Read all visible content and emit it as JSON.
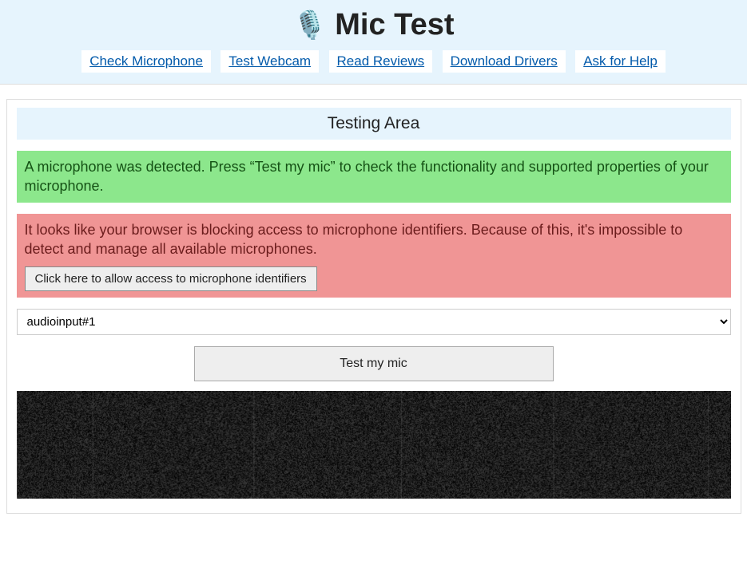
{
  "header": {
    "title": "Mic Test",
    "mic_icon": "🎙️"
  },
  "nav": [
    {
      "label": "Check Microphone"
    },
    {
      "label": "Test Webcam"
    },
    {
      "label": "Read Reviews"
    },
    {
      "label": "Download Drivers"
    },
    {
      "label": "Ask for Help"
    }
  ],
  "section_title": "Testing Area",
  "messages": {
    "detected": "A microphone was detected. Press “Test my mic” to check the functionality and supported properties of your microphone.",
    "blocked": "It looks like your browser is blocking access to microphone identifiers. Because of this, it's impossible to detect and manage all available microphones.",
    "allow_button": "Click here to allow access to microphone identifiers"
  },
  "device_select": {
    "selected": "audioinput#1"
  },
  "test_button": "Test my mic"
}
